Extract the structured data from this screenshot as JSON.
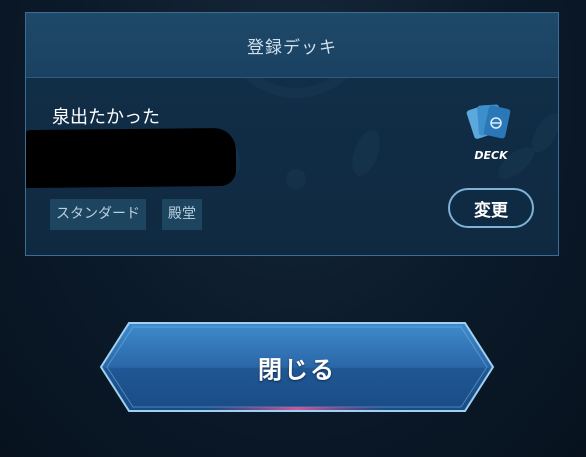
{
  "dialog": {
    "title": "登録デッキ",
    "deck": {
      "name": "泉出たかった",
      "tags": [
        "スタンダード",
        "殿堂"
      ],
      "icon": "deck-cards-icon",
      "icon_label": "DECK"
    },
    "change_label": "変更",
    "close_label": "閉じる"
  },
  "colors": {
    "panel_border": "#3a6e96",
    "header_bg": "#1f4968",
    "tag_bg": "#1d4560",
    "button_blue": "#2d6fad"
  }
}
